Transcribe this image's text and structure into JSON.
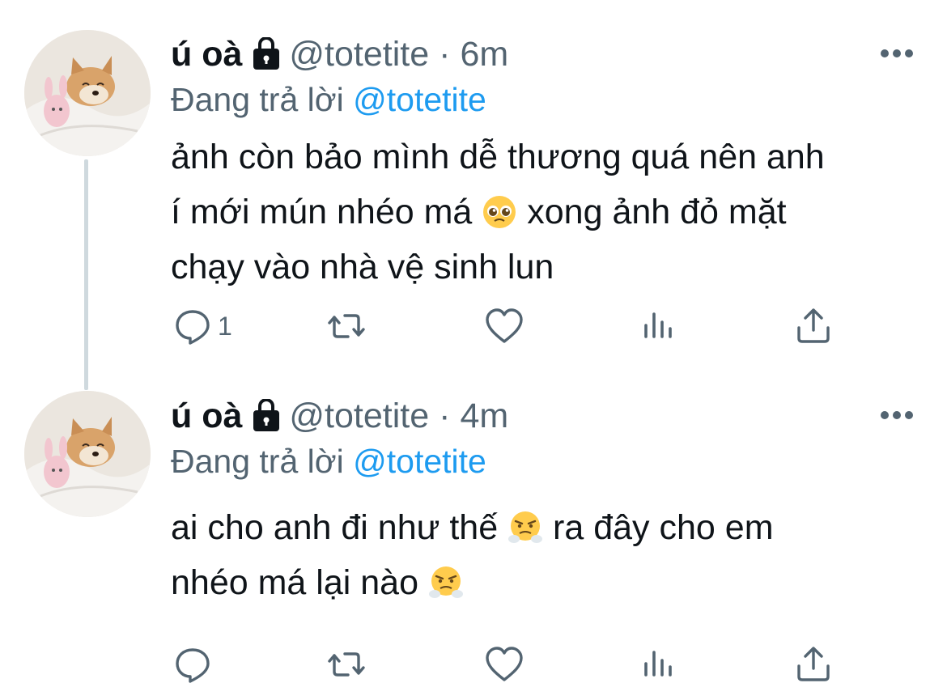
{
  "tweets": [
    {
      "display_name": "ú oà",
      "handle": "@totetite",
      "separator": "·",
      "time": "6m",
      "reply_label": "Đang trả lời",
      "reply_handle": "@totetite",
      "text_lines": [
        "ảnh còn bảo mình dễ thương quá nên anh",
        "í mới mún nhéo má",
        "xong ảnh đỏ mặt",
        "chạy vào nhà vệ sinh lun"
      ],
      "emoji": "pleading-face",
      "reply_count": "1"
    },
    {
      "display_name": "ú oà",
      "handle": "@totetite",
      "separator": "·",
      "time": "4m",
      "reply_label": "Đang trả lời",
      "reply_handle": "@totetite",
      "text_lines": [
        "ai cho anh đi như thế",
        "ra đây cho em",
        "nhéo má lại nào"
      ],
      "emoji": "face-with-steam",
      "reply_count": ""
    }
  ],
  "colors": {
    "text": "#0f1419",
    "secondary": "#536471",
    "link": "#1d9bf0",
    "thread_line": "#cfd9de"
  },
  "icons": [
    "lock-icon",
    "more-icon",
    "reply-icon",
    "retweet-icon",
    "like-icon",
    "views-icon",
    "share-icon"
  ]
}
